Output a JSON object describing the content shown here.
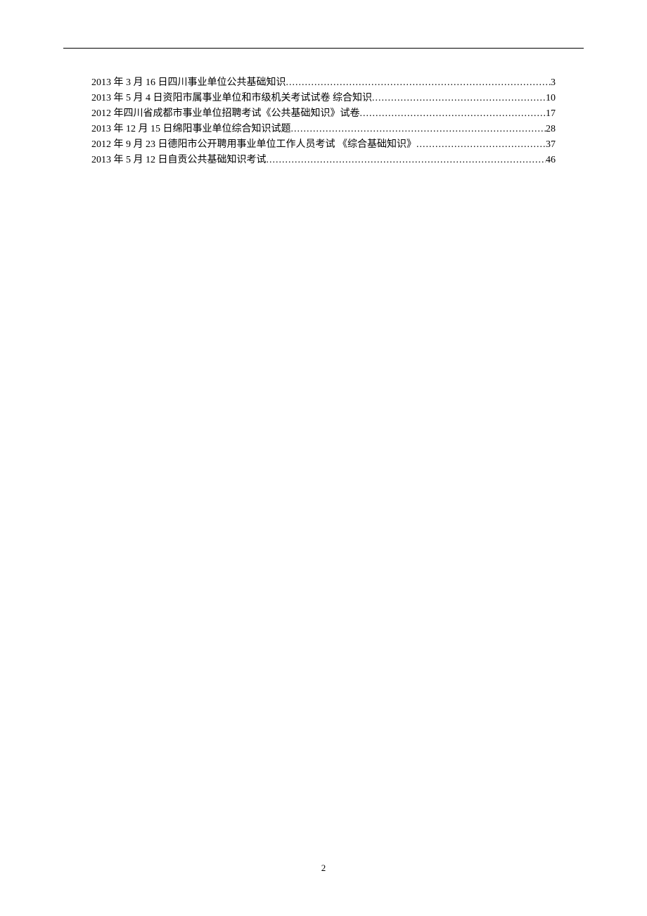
{
  "toc": {
    "entries": [
      {
        "title": "2013 年 3 月 16 日四川事业单位公共基础知识",
        "page": "3"
      },
      {
        "title": "2013 年 5 月 4 日资阳市属事业单位和市级机关考试试卷  综合知识",
        "page": "10"
      },
      {
        "title": "2012 年四川省成都市事业单位招聘考试《公共基础知识》试卷",
        "page": "17"
      },
      {
        "title": "2013 年 12 月 15 日绵阳事业单位综合知识试题",
        "page": "28"
      },
      {
        "title": "2012 年 9 月 23 日德阳市公开聘用事业单位工作人员考试 《综合基础知识》",
        "page": "37"
      },
      {
        "title": "2013 年 5 月 12 日自贡公共基础知识考试",
        "page": "46"
      }
    ]
  },
  "page_number": "2"
}
